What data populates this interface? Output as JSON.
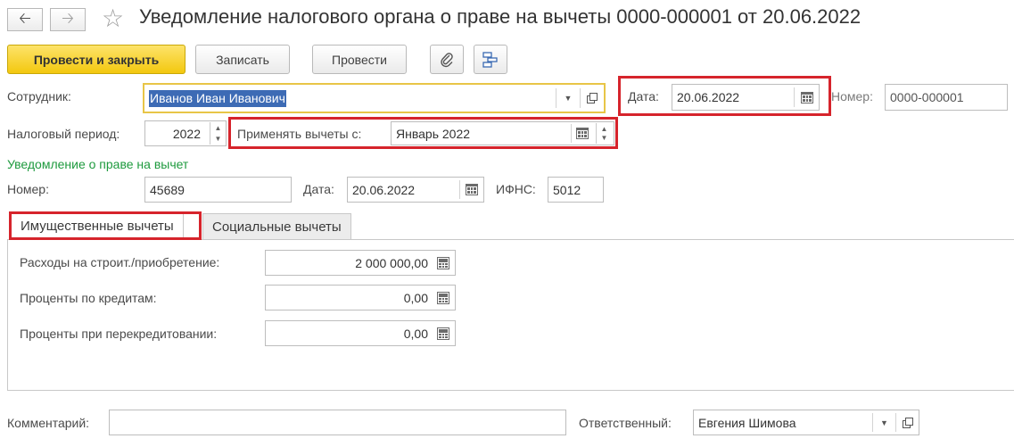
{
  "header": {
    "title": "Уведомление налогового органа о праве на вычеты 0000-000001 от 20.06.2022",
    "back_icon": "arrow-left-icon",
    "forward_icon": "arrow-right-icon",
    "favorite_icon": "star-icon"
  },
  "toolbar": {
    "post_close_label": "Провести и закрыть",
    "save_label": "Записать",
    "post_label": "Провести",
    "attach_icon": "paperclip-icon",
    "structure_icon": "document-structure-icon"
  },
  "form": {
    "employee_label": "Сотрудник:",
    "employee_value": "Иванов Иван Иванович",
    "date_label": "Дата:",
    "date_value": "20.06.2022",
    "number_label": "Номер:",
    "number_value": "0000-000001",
    "period_label": "Налоговый период:",
    "period_value": "2022",
    "apply_from_label": "Применять вычеты с:",
    "apply_from_value": "Январь 2022"
  },
  "notice": {
    "section_title": "Уведомление о праве на вычет",
    "number_label": "Номер:",
    "number_value": "45689",
    "date_label": "Дата:",
    "date_value": "20.06.2022",
    "ifns_label": "ИФНС:",
    "ifns_value": "5012"
  },
  "tabs": [
    {
      "label": "Имущественные вычеты",
      "active": true
    },
    {
      "label": "Социальные вычеты",
      "active": false
    }
  ],
  "property_deductions": [
    {
      "label": "Расходы на строит./приобретение:",
      "value": "2 000 000,00"
    },
    {
      "label": "Проценты по кредитам:",
      "value": "0,00"
    },
    {
      "label": "Проценты при перекредитовании:",
      "value": "0,00"
    }
  ],
  "footer": {
    "comment_label": "Комментарий:",
    "comment_value": "",
    "responsible_label": "Ответственный:",
    "responsible_value": "Евгения Шимова"
  },
  "colors": {
    "accent_yellow": "#f3c80f",
    "highlight_red": "#d6242c",
    "section_green": "#1e9a3e",
    "selection_blue": "#3d6bb5"
  }
}
